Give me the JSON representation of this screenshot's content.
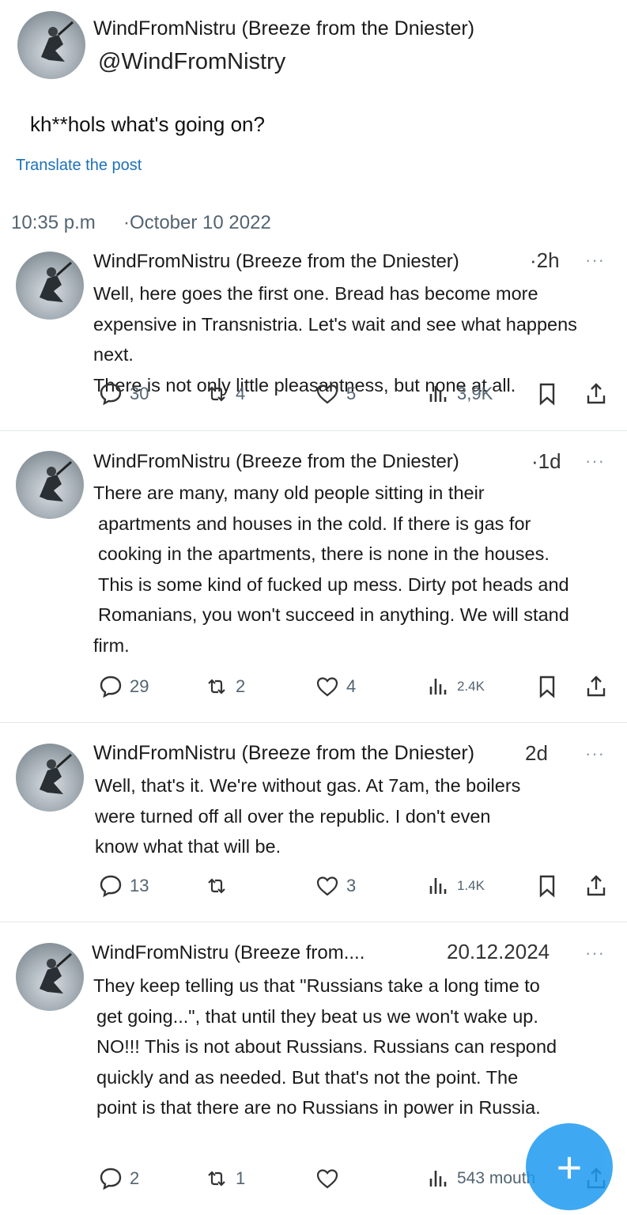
{
  "main_post": {
    "author_name": "WindFromNistru (Breeze from the Dniester)",
    "handle": "@WindFromNistry",
    "text": "kh**hols what's going on?",
    "translate_label": "Translate the post",
    "time": "10:35 p.m",
    "date": "·October 10 2022"
  },
  "replies": [
    {
      "author_name": "WindFromNistru (Breeze from the Dniester)",
      "time": "·2h",
      "menu": "···",
      "lines": [
        "Well, here goes the first one. Bread has become more",
        "expensive in Transnistria. Let's wait and see what happens next.",
        "There is not only little pleasantness, but none at all."
      ],
      "replies_count": "30",
      "reposts_count": "4",
      "likes_count": "5",
      "views_count": "3,9K"
    },
    {
      "author_name": "WindFromNistru (Breeze from the Dniester)",
      "time": "·1d",
      "menu": "···",
      "lines": [
        "There are many, many old people sitting in their",
        "apartments and houses in the cold. If there is gas for",
        "cooking in the apartments, there is none in the houses.",
        "This is some kind of fucked up mess. Dirty pot heads and",
        "Romanians, you won't succeed in anything. We will stand",
        "firm."
      ],
      "replies_count": "29",
      "reposts_count": "2",
      "likes_count": "4",
      "views_count": "2.4K"
    },
    {
      "author_name": "WindFromNistru (Breeze from the Dniester)",
      "time": "2d",
      "menu": "···",
      "lines": [
        "Well, that's it. We're without gas. At 7am, the boilers",
        "were turned off all over the republic. I don't even",
        "know what that will be."
      ],
      "replies_count": "13",
      "reposts_count": "",
      "likes_count": "3",
      "views_count": "1.4K"
    },
    {
      "author_name": "WindFromNistru (Breeze from....",
      "time": "20.12.2024",
      "menu": "···",
      "lines": [
        "They keep telling us that \"Russians take a long time to",
        "get going...\", that until they beat us we won't wake up.",
        "NO!!! This is not about Russians. Russians can respond",
        "quickly and as needed. But that's not the point. The",
        "point is that there are no Russians in power in Russia."
      ],
      "replies_count": "2",
      "reposts_count": "1",
      "likes_count": "",
      "views_count": "543 mouth"
    }
  ],
  "fab_icon": "plus-icon",
  "fab_label": "+"
}
